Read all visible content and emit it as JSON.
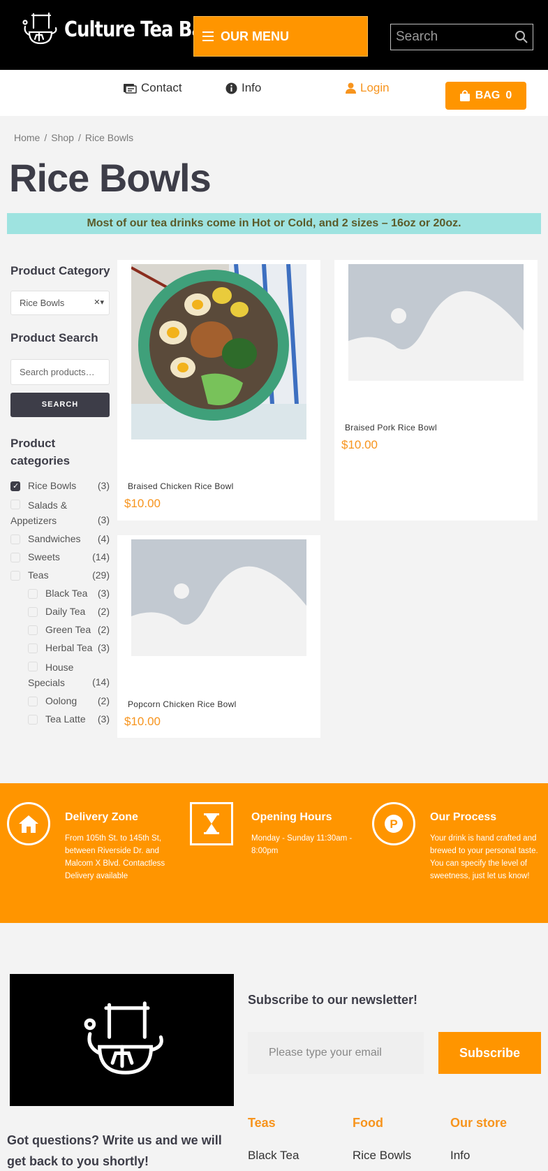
{
  "header": {
    "brand": "Culture Tea Bar",
    "menu_label": "OUR MENU",
    "search_placeholder": "Search"
  },
  "nav": {
    "contact": "Contact",
    "info": "Info",
    "login": "Login",
    "bag_label": "BAG",
    "bag_count": "0"
  },
  "breadcrumb": {
    "home": "Home",
    "sep": "/",
    "shop": "Shop",
    "current": "Rice Bowls"
  },
  "page_title": "Rice Bowls",
  "notice": "Most of our tea drinks come in Hot or Cold, and 2 sizes – 16oz or 20oz.",
  "sidebar": {
    "category_heading": "Product Category",
    "category_selected": "Rice Bowls",
    "search_heading": "Product Search",
    "search_placeholder": "Search products…",
    "search_button": "SEARCH",
    "categories_heading": "Product categories",
    "categories": [
      {
        "label": "Rice Bowls",
        "count": "(3)",
        "checked": true
      },
      {
        "label": "Salads & Appetizers",
        "count": "(3)"
      },
      {
        "label": "Sandwiches",
        "count": "(4)"
      },
      {
        "label": "Sweets",
        "count": "(14)"
      },
      {
        "label": "Teas",
        "count": "(29)"
      },
      {
        "label": "Black Tea",
        "count": "(3)"
      },
      {
        "label": "Daily Tea",
        "count": "(2)"
      },
      {
        "label": "Green Tea",
        "count": "(2)"
      },
      {
        "label": "Herbal Tea",
        "count": "(3)"
      },
      {
        "label": "House Specials",
        "count": "(14)"
      },
      {
        "label": "Oolong",
        "count": "(2)"
      },
      {
        "label": "Tea Latte",
        "count": "(3)"
      }
    ]
  },
  "products": [
    {
      "name": "Braised Chicken Rice Bowl",
      "price": "$10.00"
    },
    {
      "name": "Braised Pork Rice Bowl",
      "price": "$10.00"
    },
    {
      "name": "Popcorn Chicken Rice Bowl",
      "price": "$10.00"
    }
  ],
  "features": [
    {
      "title": "Delivery Zone",
      "text": "From 105th St. to 145th St, between Riverside Dr. and Malcom X Blvd. Contactless Delivery available",
      "icon": "home-icon"
    },
    {
      "title": "Opening Hours",
      "text": "Monday - Sunday 11:30am - 8:00pm",
      "icon": "hourglass-icon"
    },
    {
      "title": "Our Process",
      "text": "Your drink is hand crafted and brewed to your personal taste. You can specify the level of sweetness, just let us know!",
      "icon": "parking-p-icon"
    }
  ],
  "footer": {
    "newsletter_heading": "Subscribe to our newsletter!",
    "email_placeholder": "Please type your email",
    "subscribe_label": "Subscribe",
    "questions": "Got questions? Write us and we will get back to you shortly!",
    "columns": [
      {
        "heading": "Teas",
        "item": "Black Tea"
      },
      {
        "heading": "Food",
        "item": "Rice Bowls"
      },
      {
        "heading": "Our store",
        "item": "Info"
      }
    ]
  },
  "colors": {
    "accent": "#ff9500",
    "dark": "#3d3d48",
    "notice_bg": "#9ee3e0"
  }
}
